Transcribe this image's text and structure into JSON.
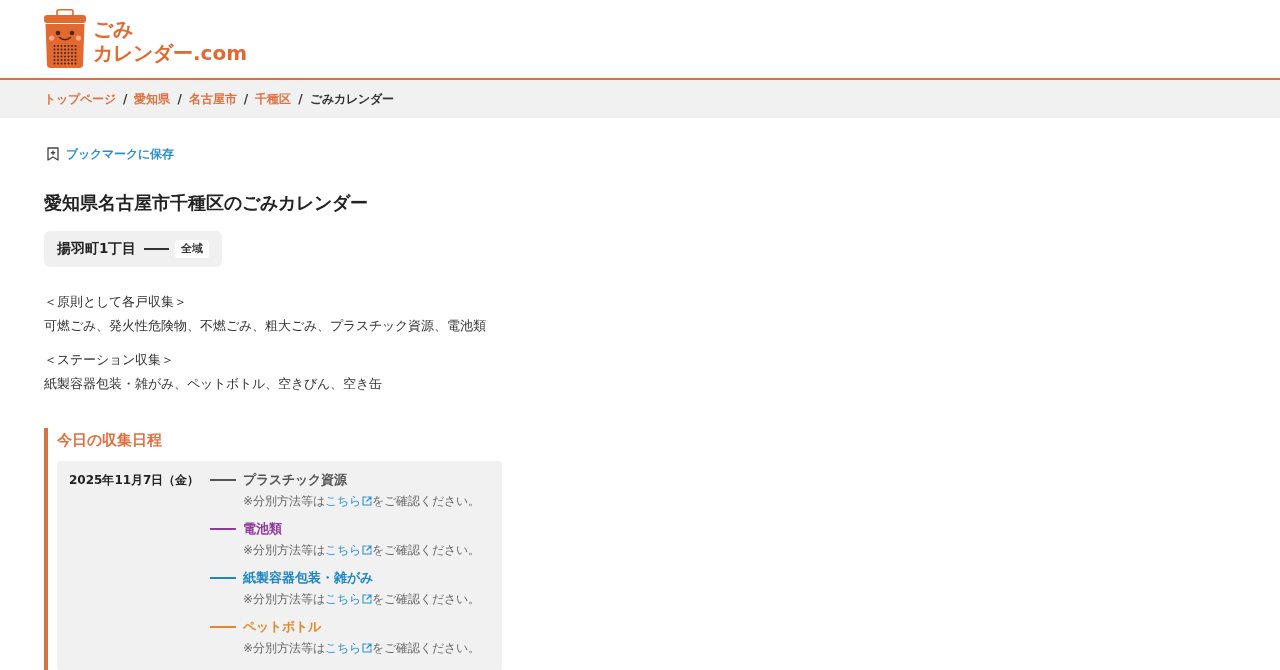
{
  "header": {
    "logo_lines": [
      "ごみ",
      "カレンダー.com"
    ]
  },
  "breadcrumb": [
    {
      "label": "トップページ",
      "current": false,
      "separator": "/"
    },
    {
      "label": "愛知県",
      "current": false,
      "separator": "/"
    },
    {
      "label": "名古屋市",
      "current": false,
      "separator": "/"
    },
    {
      "label": "千種区",
      "current": false,
      "separator": "/"
    },
    {
      "label": "ごみカレンダー",
      "current": true
    }
  ],
  "bookmark": {
    "label": "ブックマークに保存"
  },
  "page_title": "愛知県名古屋市千種区のごみカレンダー",
  "area": {
    "name": "揚羽町1丁目",
    "zone": "全域"
  },
  "collection_rules": [
    {
      "heading": "＜原則として各戸収集＞",
      "text": "可燃ごみ、発火性危険物、不燃ごみ、粗大ごみ、プラスチック資源、電池類"
    },
    {
      "heading": "＜ステーション収集＞",
      "text": "紙製容器包装・雑がみ、ペットボトル、空きびん、空き缶"
    }
  ],
  "today": {
    "heading": "今日の収集日程",
    "date": "2025年11月7日（金）",
    "items": [
      {
        "name": "プラスチック資源",
        "color": "#555555",
        "note_before": "※分別方法等は",
        "link": "こちら",
        "note_after": "をご確認ください。"
      },
      {
        "name": "電池類",
        "color": "#8e3a9e",
        "note_before": "※分別方法等は",
        "link": "こちら",
        "note_after": "をご確認ください。"
      },
      {
        "name": "紙製容器包装・雑がみ",
        "color": "#1e86c4",
        "note_before": "※分別方法等は",
        "link": "こちら",
        "note_after": "をご確認ください。"
      },
      {
        "name": "ペットボトル",
        "color": "#e0892b",
        "note_before": "※分別方法等は",
        "link": "こちら",
        "note_after": "をご確認ください。"
      }
    ]
  }
}
